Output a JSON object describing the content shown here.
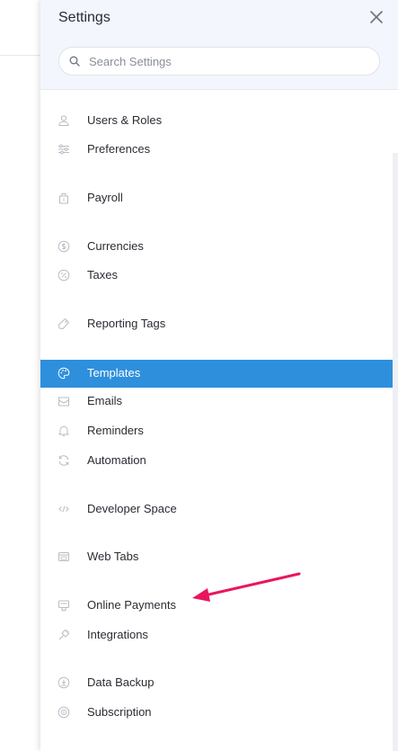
{
  "panel": {
    "title": "Settings",
    "close_icon": "close-icon"
  },
  "search": {
    "placeholder": "Search Settings",
    "value": "",
    "icon": "search-icon"
  },
  "menu": {
    "items": [
      {
        "label": "Users & Roles",
        "icon": "users-icon"
      },
      {
        "label": "Preferences",
        "icon": "sliders-icon"
      },
      {
        "label": "Payroll",
        "icon": "payroll-icon"
      },
      {
        "label": "Currencies",
        "icon": "currency-icon"
      },
      {
        "label": "Taxes",
        "icon": "percent-icon"
      },
      {
        "label": "Reporting Tags",
        "icon": "tag-icon"
      },
      {
        "label": "Templates",
        "icon": "palette-icon",
        "active": true
      },
      {
        "label": "Emails",
        "icon": "mail-icon"
      },
      {
        "label": "Reminders",
        "icon": "bell-icon"
      },
      {
        "label": "Automation",
        "icon": "refresh-icon"
      },
      {
        "label": "Developer Space",
        "icon": "code-icon"
      },
      {
        "label": "Web Tabs",
        "icon": "browser-tab-icon"
      },
      {
        "label": "Online Payments",
        "icon": "payment-terminal-icon"
      },
      {
        "label": "Integrations",
        "icon": "plug-icon"
      },
      {
        "label": "Data Backup",
        "icon": "backup-icon"
      },
      {
        "label": "Subscription",
        "icon": "subscription-icon"
      }
    ]
  },
  "colors": {
    "accent": "#2e8fdc",
    "header_bg": "#f3f6fc",
    "annotation_arrow": "#e8175d"
  }
}
